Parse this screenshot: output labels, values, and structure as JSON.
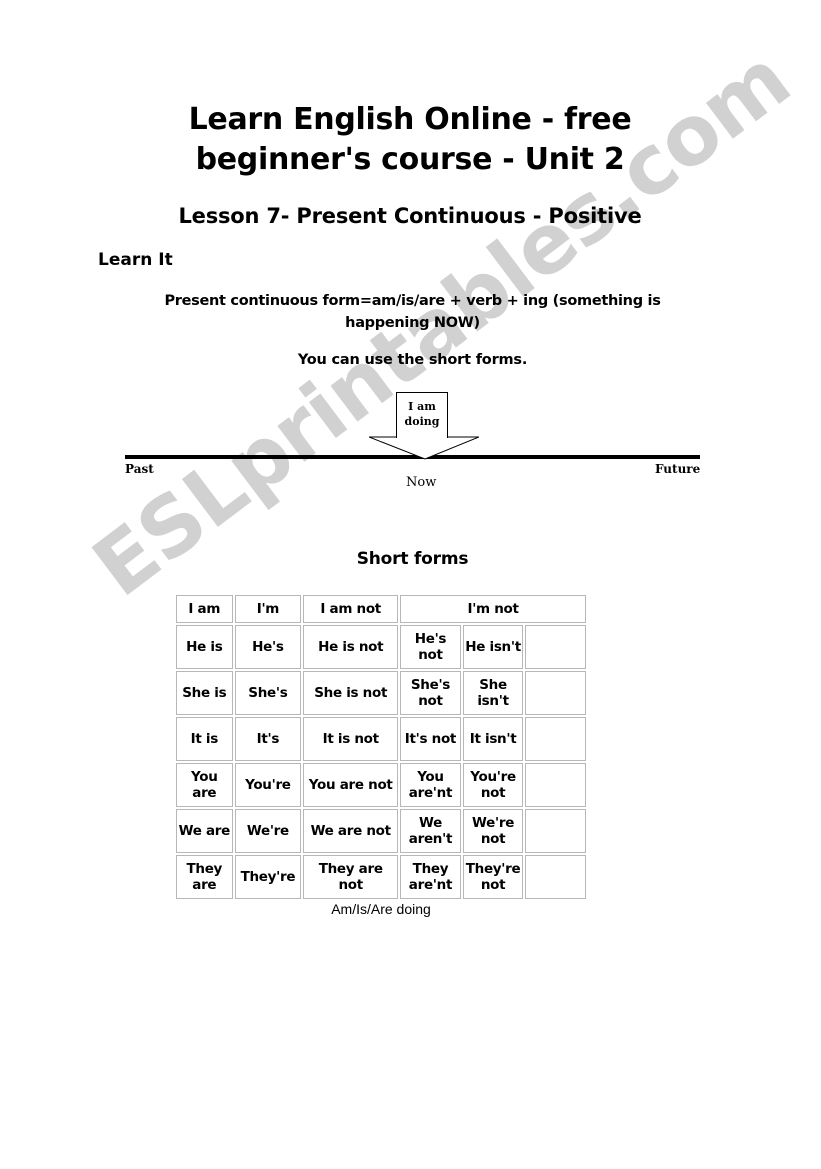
{
  "document": {
    "title": "Learn English Online - free beginner's course - Unit 2",
    "subtitle": "Lesson 7- Present Continuous - Positive",
    "watermark": "ESLprintables.com"
  },
  "learn_section": {
    "heading": "Learn It",
    "formula": "Present continuous form=am/is/are + verb + ing (something is happening NOW)",
    "note": "You can use the short forms."
  },
  "timeline": {
    "box_line1": "I am",
    "box_line2": "doing",
    "past_label": "Past",
    "now_label": "Now",
    "future_label": "Future"
  },
  "short_forms": {
    "heading": "Short forms",
    "caption": "Am/Is/Are doing",
    "header_row": {
      "c1": "I am",
      "c2": "I'm",
      "c3": "I am not",
      "c4_span": "I'm not"
    },
    "rows": [
      {
        "c1": "He is",
        "c2": "He's",
        "c3": "He is not",
        "c4": "He's not",
        "c5": "He isn't",
        "c6": ""
      },
      {
        "c1": "She is",
        "c2": "She's",
        "c3": "She is not",
        "c4": "She's not",
        "c5": "She isn't",
        "c6": ""
      },
      {
        "c1": "It is",
        "c2": "It's",
        "c3": "It is not",
        "c4": "It's not",
        "c5": "It isn't",
        "c6": ""
      },
      {
        "c1": "You are",
        "c2": "You're",
        "c3": "You are not",
        "c4": "You are'nt",
        "c5": "You're not",
        "c6": ""
      },
      {
        "c1": "We are",
        "c2": "We're",
        "c3": "We are not",
        "c4": "We aren't",
        "c5": "We're not",
        "c6": ""
      },
      {
        "c1": "They are",
        "c2": "They're",
        "c3": "They are not",
        "c4": "They are'nt",
        "c5": "They're not",
        "c6": ""
      }
    ]
  }
}
